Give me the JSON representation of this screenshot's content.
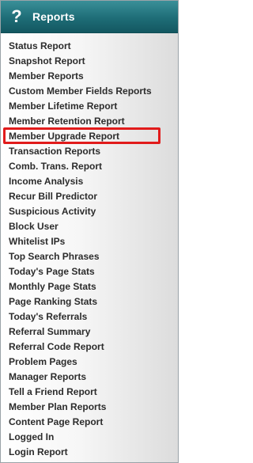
{
  "header": {
    "title": "Reports",
    "icon": "help-icon",
    "icon_glyph": "?",
    "background_color": "#1e6d77"
  },
  "highlight_color": "#e11b1b",
  "menu": {
    "items": [
      "Status Report",
      "Snapshot Report",
      "Member Reports",
      "Custom Member Fields Reports",
      "Member Lifetime Report",
      "Member Retention Report",
      "Member Upgrade Report",
      "Transaction Reports",
      "Comb. Trans. Report",
      "Income Analysis",
      "Recur Bill Predictor",
      "Suspicious Activity",
      "Block User",
      "Whitelist IPs",
      "Top Search Phrases",
      "Today's Page Stats",
      "Monthly Page Stats",
      "Page Ranking Stats",
      "Today's Referrals",
      "Referral Summary",
      "Referral Code Report",
      "Problem Pages",
      "Manager Reports",
      "Tell a Friend Report",
      "Member Plan Reports",
      "Content Page Report",
      "Logged In",
      "Login Report"
    ],
    "highlighted_item": "Member Upgrade Report"
  }
}
